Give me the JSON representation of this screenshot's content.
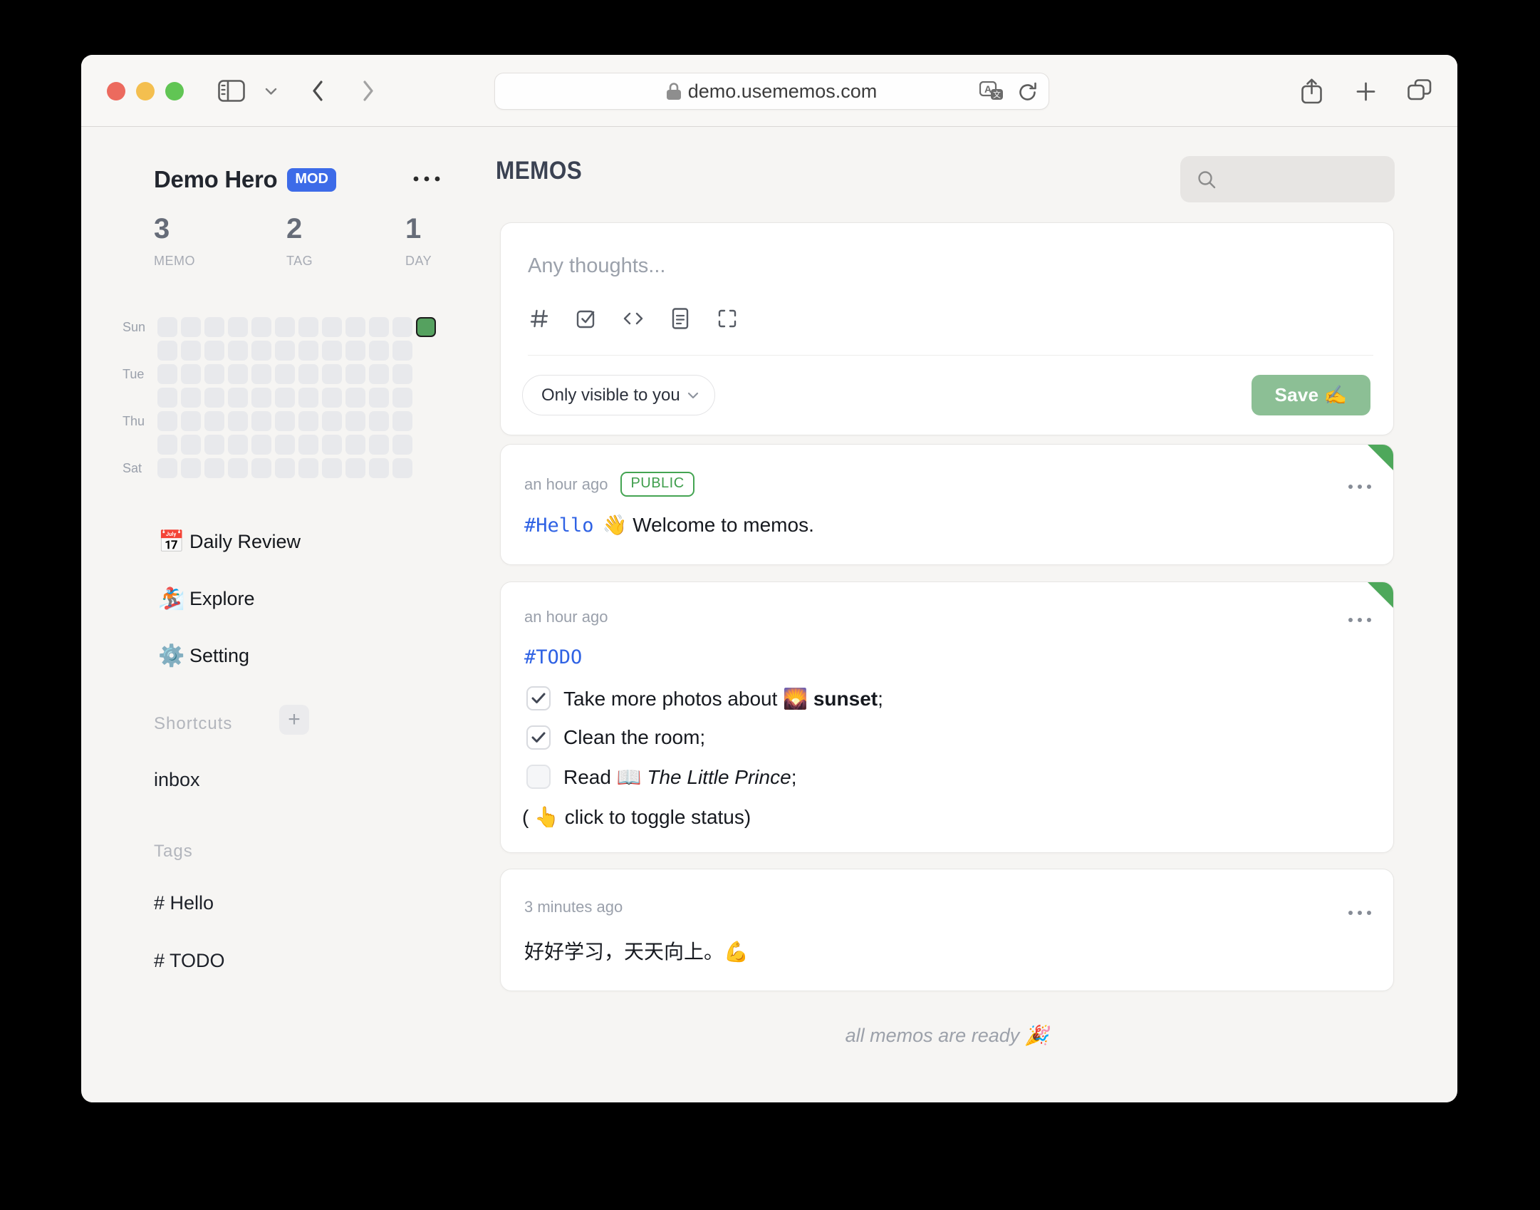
{
  "browser": {
    "url": "demo.usememos.com",
    "traffic_light_colors": {
      "close": "#ec6a5e",
      "minimize": "#f4bf4f",
      "zoom": "#61c554"
    }
  },
  "sidebar": {
    "user_name": "Demo Hero",
    "user_badge": "MOD",
    "stats": [
      {
        "value": "3",
        "label": "MEMO"
      },
      {
        "value": "2",
        "label": "TAG"
      },
      {
        "value": "1",
        "label": "DAY"
      }
    ],
    "heatmap": {
      "day_labels": [
        "Sun",
        "",
        "Tue",
        "",
        "Thu",
        "",
        "Sat"
      ],
      "weeks": 12,
      "today": {
        "row": 0,
        "col": 11
      },
      "cell_color": "#e8e9ec",
      "today_color": "#55a15f"
    },
    "nav": [
      {
        "icon": "📅",
        "label": "Daily Review"
      },
      {
        "icon": "🏂",
        "label": "Explore"
      },
      {
        "icon": "⚙️",
        "label": "Setting"
      }
    ],
    "shortcuts_title": "Shortcuts",
    "shortcuts_add": "+",
    "shortcut_items": [
      "inbox"
    ],
    "tags_title": "Tags",
    "tag_items": [
      "# Hello",
      "# TODO"
    ]
  },
  "main": {
    "title": "MEMOS",
    "editor": {
      "placeholder": "Any thoughts...",
      "visibility": "Only visible to you",
      "save": "Save ✍️"
    },
    "memos": [
      {
        "time": "an hour ago",
        "badge": "PUBLIC",
        "tag": "#Hello",
        "text": "👋 Welcome to memos."
      },
      {
        "time": "an hour ago",
        "tag": "#TODO",
        "tasks": [
          {
            "checked": true,
            "pre": "Take more photos about 🌄 ",
            "bold": "sunset",
            "italic": "",
            "post": ";"
          },
          {
            "checked": true,
            "pre": "Clean the room;",
            "bold": "",
            "italic": "",
            "post": ""
          },
          {
            "checked": false,
            "pre": "Read 📖 ",
            "bold": "",
            "italic": "The Little Prince",
            "post": ";"
          }
        ],
        "note": "( 👆  click to toggle status)"
      },
      {
        "time": "3 minutes ago",
        "text": "好好学习，天天向上。💪"
      }
    ],
    "footer": "all memos are ready 🎉"
  }
}
